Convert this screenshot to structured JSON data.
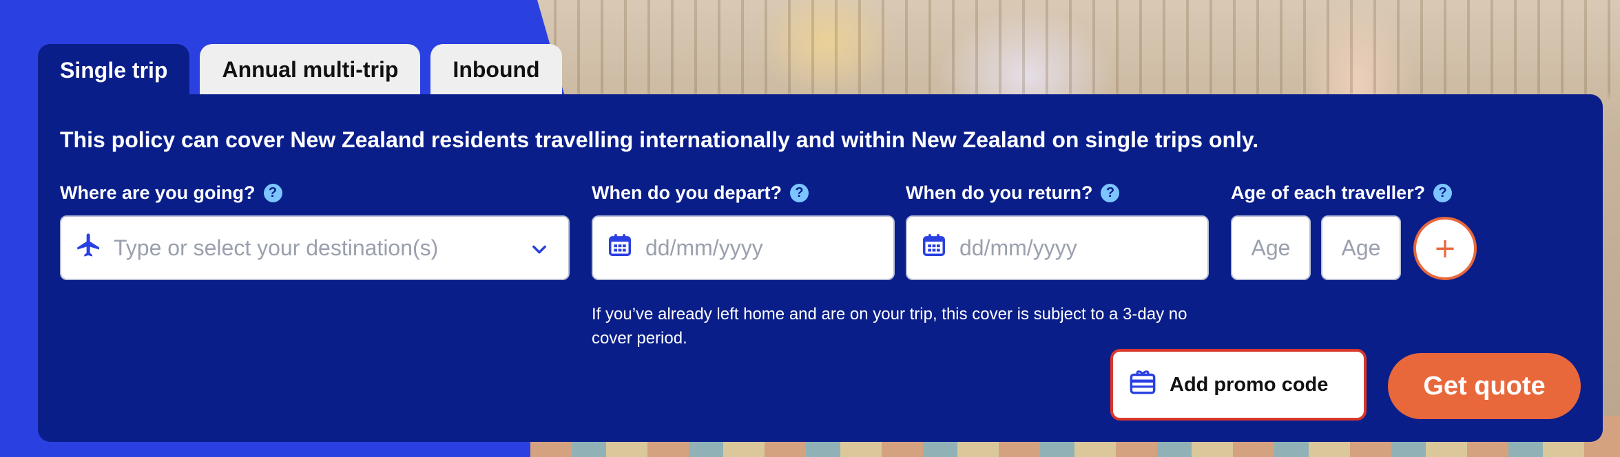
{
  "tabs": [
    {
      "label": "Single trip",
      "active": true
    },
    {
      "label": "Annual multi-trip",
      "active": false
    },
    {
      "label": "Inbound",
      "active": false
    }
  ],
  "intro": "This policy can cover New Zealand residents travelling internationally and within New Zealand on single trips only.",
  "fields": {
    "destination": {
      "label": "Where are you going?",
      "placeholder": "Type or select your destination(s)",
      "value": ""
    },
    "depart": {
      "label": "When do you depart?",
      "placeholder": "dd/mm/yyyy",
      "value": ""
    },
    "return": {
      "label": "When do you return?",
      "placeholder": "dd/mm/yyyy",
      "value": ""
    },
    "ages": {
      "label": "Age of each traveller?",
      "placeholders": [
        "Age",
        "Age"
      ]
    }
  },
  "help_glyph": "?",
  "add_traveller_glyph": "+",
  "notice": "If you’ve already left home and are on your trip, this cover is subject to a 3-day no cover period.",
  "promo": {
    "label": "Add promo code"
  },
  "cta": {
    "label": "Get quote"
  },
  "icons": {
    "destination": "plane-icon",
    "dropdown": "chevron-down-icon",
    "date": "calendar-icon",
    "help": "question-mark-icon",
    "promo": "gift-card-icon"
  },
  "colors": {
    "brand_blue": "#2a40e0",
    "panel_navy": "#0a1e8a",
    "accent_orange": "#e8683c",
    "help_light_blue": "#7cc5ff",
    "promo_border_red": "#d9372c"
  }
}
